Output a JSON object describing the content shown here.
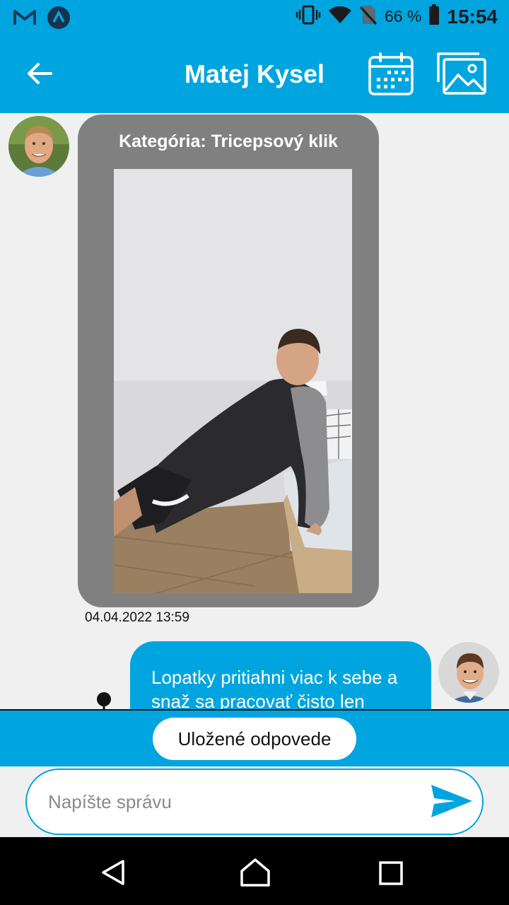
{
  "status_bar": {
    "battery_percent": "66 %",
    "time": "15:54",
    "icons": [
      "gmail-icon",
      "app-icon",
      "vibrate-icon",
      "wifi-icon",
      "no-sim-icon",
      "battery-icon"
    ]
  },
  "header": {
    "title": "Matej Kysel",
    "icons": [
      "back-arrow-icon",
      "calendar-icon",
      "gallery-icon"
    ]
  },
  "messages": [
    {
      "type": "photo",
      "from": "coach",
      "category": "Kategória: Tricepsový klik",
      "timestamp": "04.04.2022 13:59"
    },
    {
      "type": "text",
      "from": "user",
      "text": "Lopatky pritiahni viac k sebe a snaž sa pracovať čisto len"
    }
  ],
  "saved_replies": {
    "label": "Uložené odpovede"
  },
  "composer": {
    "placeholder": "Napíšte správu",
    "value": ""
  },
  "colors": {
    "accent": "#00a5df",
    "photo_bubble": "#808080",
    "background": "#f0f0f0"
  }
}
